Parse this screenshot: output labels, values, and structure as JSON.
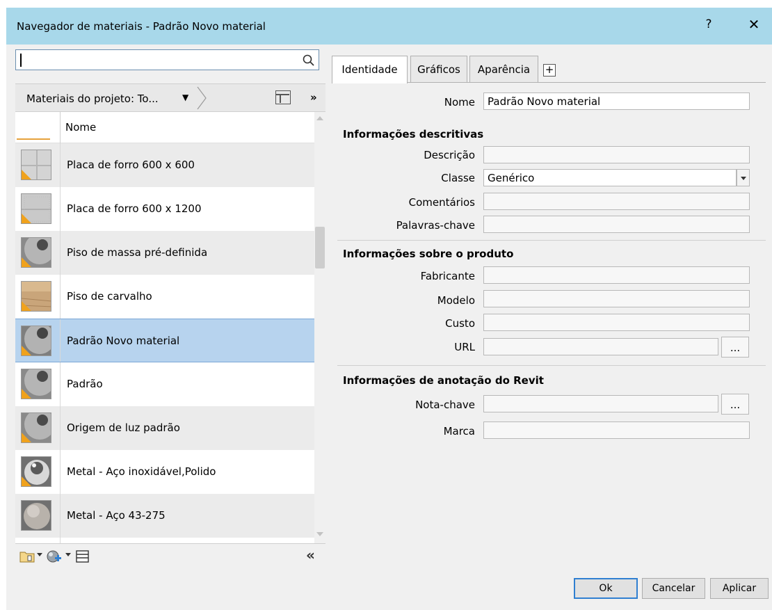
{
  "window": {
    "title": "Navegador de materiais - Padrão Novo material",
    "help_label": "?",
    "close_label": "✕"
  },
  "left": {
    "search": {
      "value": "",
      "placeholder": ""
    },
    "filter": {
      "label": "Materiais do projeto: To...",
      "more_label": "»"
    },
    "list_header": "Nome",
    "materials": [
      {
        "name": "Placa de forro 600 x 600",
        "icon": "ceiling-tile-600-icon"
      },
      {
        "name": "Placa de forro 600 x 1200",
        "icon": "ceiling-tile-1200-icon"
      },
      {
        "name": "Piso de massa pré-definida",
        "icon": "sphere-gray-icon"
      },
      {
        "name": "Piso de carvalho",
        "icon": "wood-icon"
      },
      {
        "name": "Padrão Novo material",
        "icon": "sphere-gray-icon",
        "selected": true
      },
      {
        "name": "Padrão",
        "icon": "sphere-gray-icon"
      },
      {
        "name": "Origem de luz padrão",
        "icon": "sphere-gray-icon"
      },
      {
        "name": "Metal - Aço inoxidável,Polido",
        "icon": "sphere-chrome-icon"
      },
      {
        "name": "Metal - Aço 43-275",
        "icon": "sphere-steel-icon"
      }
    ],
    "collapse_label": "«"
  },
  "tabs": [
    "Identidade",
    "Gráficos",
    "Aparência"
  ],
  "tab_add_label": "+",
  "identity": {
    "name_label": "Nome",
    "name_value": "Padrão Novo material",
    "sections": {
      "descriptive": {
        "title": "Informações descritivas",
        "description_label": "Descrição",
        "description_value": "",
        "class_label": "Classe",
        "class_value": "Genérico",
        "comments_label": "Comentários",
        "comments_value": "",
        "keywords_label": "Palavras-chave",
        "keywords_value": ""
      },
      "product": {
        "title": "Informações sobre o produto",
        "manufacturer_label": "Fabricante",
        "model_label": "Modelo",
        "cost_label": "Custo",
        "url_label": "URL",
        "ellipsis": "..."
      },
      "revit": {
        "title": "Informações de anotação do Revit",
        "keynote_label": "Nota-chave",
        "mark_label": "Marca",
        "ellipsis": "..."
      }
    }
  },
  "footer": {
    "ok": "Ok",
    "cancel": "Cancelar",
    "apply": "Aplicar"
  },
  "colors": {
    "titlebar": "#a8d8ea",
    "selection": "#b7d3ee",
    "warning": "#f0a21c"
  }
}
